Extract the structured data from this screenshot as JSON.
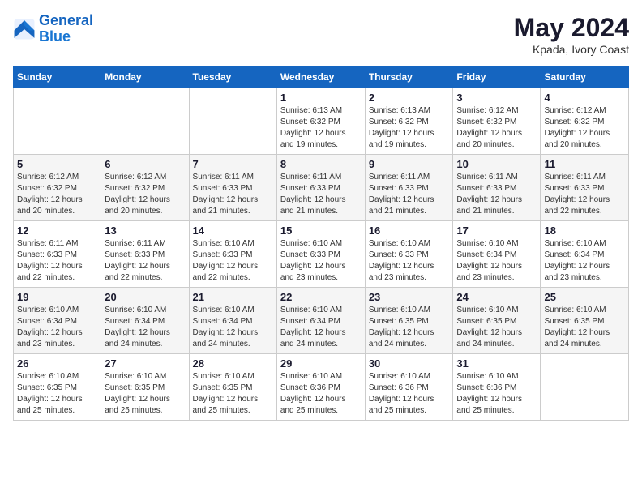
{
  "header": {
    "logo_line1": "General",
    "logo_line2": "Blue",
    "month_year": "May 2024",
    "location": "Kpada, Ivory Coast"
  },
  "weekdays": [
    "Sunday",
    "Monday",
    "Tuesday",
    "Wednesday",
    "Thursday",
    "Friday",
    "Saturday"
  ],
  "weeks": [
    [
      {
        "day": "",
        "info": ""
      },
      {
        "day": "",
        "info": ""
      },
      {
        "day": "",
        "info": ""
      },
      {
        "day": "1",
        "info": "Sunrise: 6:13 AM\nSunset: 6:32 PM\nDaylight: 12 hours\nand 19 minutes."
      },
      {
        "day": "2",
        "info": "Sunrise: 6:13 AM\nSunset: 6:32 PM\nDaylight: 12 hours\nand 19 minutes."
      },
      {
        "day": "3",
        "info": "Sunrise: 6:12 AM\nSunset: 6:32 PM\nDaylight: 12 hours\nand 20 minutes."
      },
      {
        "day": "4",
        "info": "Sunrise: 6:12 AM\nSunset: 6:32 PM\nDaylight: 12 hours\nand 20 minutes."
      }
    ],
    [
      {
        "day": "5",
        "info": "Sunrise: 6:12 AM\nSunset: 6:32 PM\nDaylight: 12 hours\nand 20 minutes."
      },
      {
        "day": "6",
        "info": "Sunrise: 6:12 AM\nSunset: 6:32 PM\nDaylight: 12 hours\nand 20 minutes."
      },
      {
        "day": "7",
        "info": "Sunrise: 6:11 AM\nSunset: 6:33 PM\nDaylight: 12 hours\nand 21 minutes."
      },
      {
        "day": "8",
        "info": "Sunrise: 6:11 AM\nSunset: 6:33 PM\nDaylight: 12 hours\nand 21 minutes."
      },
      {
        "day": "9",
        "info": "Sunrise: 6:11 AM\nSunset: 6:33 PM\nDaylight: 12 hours\nand 21 minutes."
      },
      {
        "day": "10",
        "info": "Sunrise: 6:11 AM\nSunset: 6:33 PM\nDaylight: 12 hours\nand 21 minutes."
      },
      {
        "day": "11",
        "info": "Sunrise: 6:11 AM\nSunset: 6:33 PM\nDaylight: 12 hours\nand 22 minutes."
      }
    ],
    [
      {
        "day": "12",
        "info": "Sunrise: 6:11 AM\nSunset: 6:33 PM\nDaylight: 12 hours\nand 22 minutes."
      },
      {
        "day": "13",
        "info": "Sunrise: 6:11 AM\nSunset: 6:33 PM\nDaylight: 12 hours\nand 22 minutes."
      },
      {
        "day": "14",
        "info": "Sunrise: 6:10 AM\nSunset: 6:33 PM\nDaylight: 12 hours\nand 22 minutes."
      },
      {
        "day": "15",
        "info": "Sunrise: 6:10 AM\nSunset: 6:33 PM\nDaylight: 12 hours\nand 23 minutes."
      },
      {
        "day": "16",
        "info": "Sunrise: 6:10 AM\nSunset: 6:33 PM\nDaylight: 12 hours\nand 23 minutes."
      },
      {
        "day": "17",
        "info": "Sunrise: 6:10 AM\nSunset: 6:34 PM\nDaylight: 12 hours\nand 23 minutes."
      },
      {
        "day": "18",
        "info": "Sunrise: 6:10 AM\nSunset: 6:34 PM\nDaylight: 12 hours\nand 23 minutes."
      }
    ],
    [
      {
        "day": "19",
        "info": "Sunrise: 6:10 AM\nSunset: 6:34 PM\nDaylight: 12 hours\nand 23 minutes."
      },
      {
        "day": "20",
        "info": "Sunrise: 6:10 AM\nSunset: 6:34 PM\nDaylight: 12 hours\nand 24 minutes."
      },
      {
        "day": "21",
        "info": "Sunrise: 6:10 AM\nSunset: 6:34 PM\nDaylight: 12 hours\nand 24 minutes."
      },
      {
        "day": "22",
        "info": "Sunrise: 6:10 AM\nSunset: 6:34 PM\nDaylight: 12 hours\nand 24 minutes."
      },
      {
        "day": "23",
        "info": "Sunrise: 6:10 AM\nSunset: 6:35 PM\nDaylight: 12 hours\nand 24 minutes."
      },
      {
        "day": "24",
        "info": "Sunrise: 6:10 AM\nSunset: 6:35 PM\nDaylight: 12 hours\nand 24 minutes."
      },
      {
        "day": "25",
        "info": "Sunrise: 6:10 AM\nSunset: 6:35 PM\nDaylight: 12 hours\nand 24 minutes."
      }
    ],
    [
      {
        "day": "26",
        "info": "Sunrise: 6:10 AM\nSunset: 6:35 PM\nDaylight: 12 hours\nand 25 minutes."
      },
      {
        "day": "27",
        "info": "Sunrise: 6:10 AM\nSunset: 6:35 PM\nDaylight: 12 hours\nand 25 minutes."
      },
      {
        "day": "28",
        "info": "Sunrise: 6:10 AM\nSunset: 6:35 PM\nDaylight: 12 hours\nand 25 minutes."
      },
      {
        "day": "29",
        "info": "Sunrise: 6:10 AM\nSunset: 6:36 PM\nDaylight: 12 hours\nand 25 minutes."
      },
      {
        "day": "30",
        "info": "Sunrise: 6:10 AM\nSunset: 6:36 PM\nDaylight: 12 hours\nand 25 minutes."
      },
      {
        "day": "31",
        "info": "Sunrise: 6:10 AM\nSunset: 6:36 PM\nDaylight: 12 hours\nand 25 minutes."
      },
      {
        "day": "",
        "info": ""
      }
    ]
  ]
}
